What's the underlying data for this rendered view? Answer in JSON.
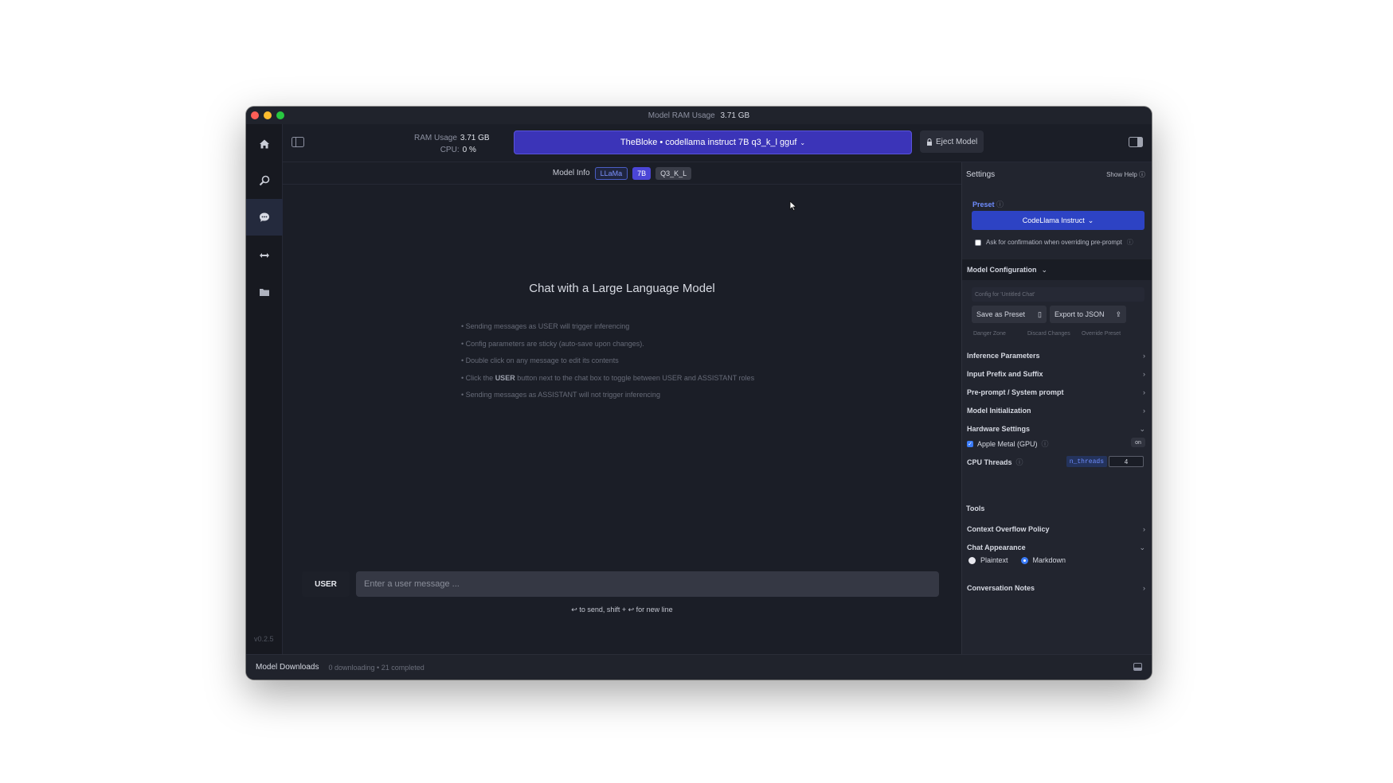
{
  "window": {
    "title_label": "Model RAM Usage",
    "title_value": "3.71 GB",
    "lights": {
      "close": "#ff5f57",
      "minimize": "#febc2e",
      "zoom": "#28c840"
    }
  },
  "rail": {
    "items": [
      {
        "icon": "home-icon",
        "glyph": "⌂"
      },
      {
        "icon": "search-icon",
        "glyph": "⌕"
      },
      {
        "icon": "chat-icon",
        "glyph": "💬"
      },
      {
        "icon": "server-icon",
        "glyph": "↔"
      },
      {
        "icon": "folder-icon",
        "glyph": "▬"
      }
    ],
    "version": "v0.2.5"
  },
  "topbar": {
    "ram_label": "RAM Usage",
    "ram_value": "3.71 GB",
    "cpu_label": "CPU:",
    "cpu_value": "0 %",
    "model_name": "TheBloke • codellama instruct 7B q3_k_l gguf",
    "eject_label": "Eject Model"
  },
  "model_info": {
    "label": "Model Info",
    "tags": [
      "LLaMa",
      "7B",
      "Q3_K_L"
    ]
  },
  "chat": {
    "heading": "Chat with a Large Language Model",
    "tips": [
      "Sending messages as USER will trigger inferencing",
      "Config parameters are sticky (auto-save upon changes).",
      "Double click on any message to edit its contents",
      "Click the {USER} button next to the chat box to toggle between USER and ASSISTANT roles",
      "Sending messages as ASSISTANT will not trigger inferencing"
    ],
    "tip4_prefix": "Click the",
    "tip4_bold": "USER",
    "tip4_suffix": "button next to the chat box to toggle between USER and ASSISTANT roles",
    "role": "USER",
    "input_placeholder": "Enter a user message ...",
    "send_hint": "↩ to send, shift + ↩ for new line"
  },
  "settings": {
    "title": "Settings",
    "show_help": "Show Help",
    "preset_label": "Preset",
    "preset_value": "CodeLlama Instruct",
    "confirm_label": "Ask for confirmation when overriding pre-prompt",
    "model_config_label": "Model Configuration",
    "config_for": "Config for 'Untitled Chat'",
    "save_preset": "Save as Preset",
    "export_json": "Export to JSON",
    "danger_zone": "Danger Zone",
    "discard_changes": "Discard Changes",
    "override_preset": "Override Preset",
    "sections": [
      "Inference Parameters",
      "Input Prefix and Suffix",
      "Pre-prompt / System prompt",
      "Model Initialization",
      "Hardware Settings"
    ],
    "gpu_label": "Apple Metal (GPU)",
    "gpu_state": "on",
    "cpu_threads_label": "CPU Threads",
    "n_threads_tag": "n_threads",
    "cpu_threads_value": "4",
    "tools_label": "Tools",
    "context_overflow": "Context Overflow Policy",
    "chat_appearance": "Chat Appearance",
    "plaintext": "Plaintext",
    "markdown": "Markdown",
    "conversation_notes": "Conversation Notes"
  },
  "footer": {
    "downloads_label": "Model Downloads",
    "downloads_status": "0 downloading • 21 completed"
  },
  "colors": {
    "accent": "#3b34b8",
    "preset_blue": "#2d43c4",
    "background": "#1b1e27"
  }
}
